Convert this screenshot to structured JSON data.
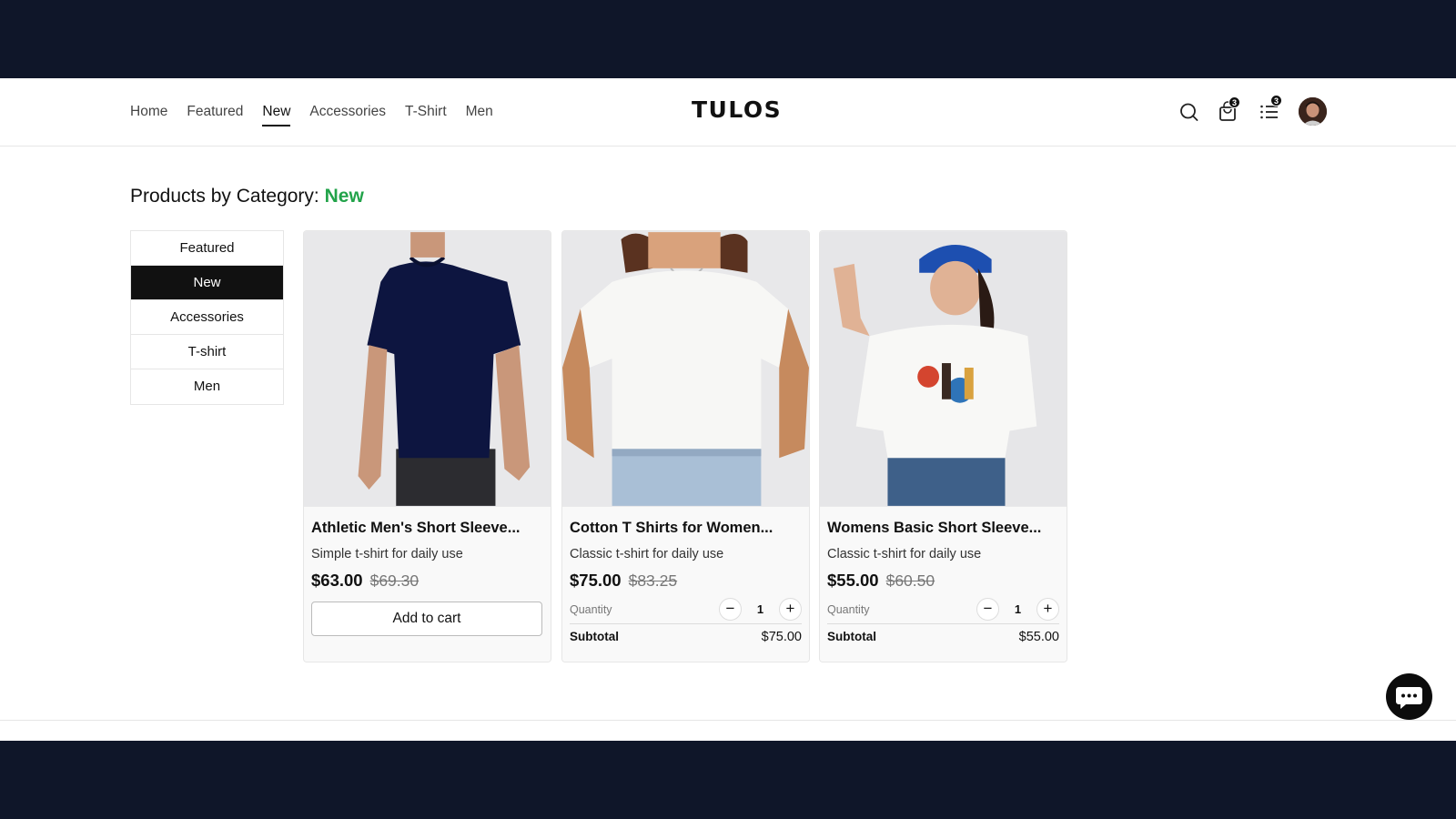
{
  "header": {
    "nav": [
      "Home",
      "Featured",
      "New",
      "Accessories",
      "T-Shirt",
      "Men"
    ],
    "active_nav": "New",
    "logo": "TULOS",
    "cart_count": "3",
    "orders_count": "3",
    "icons": [
      "search-icon",
      "shopping-bag-icon",
      "list-icon",
      "avatar"
    ]
  },
  "page": {
    "title_prefix": "Products by Category:",
    "title_category": "New",
    "accent_color": "#22a34a"
  },
  "sidebar": {
    "items": [
      "Featured",
      "New",
      "Accessories",
      "T-shirt",
      "Men"
    ],
    "active": "New"
  },
  "products": [
    {
      "name": "Athletic Men's Short Sleeve...",
      "description": "Simple t-shirt for daily use",
      "price": "$63.00",
      "old_price": "$69.30",
      "action_label": "Add to cart"
    },
    {
      "name": "Cotton T Shirts for Women...",
      "description": "Classic t-shirt for daily use",
      "price": "$75.00",
      "old_price": "$83.25",
      "quantity_label": "Quantity",
      "quantity": "1",
      "subtotal_label": "Subtotal",
      "subtotal": "$75.00"
    },
    {
      "name": "Womens Basic Short Sleeve...",
      "description": "Classic t-shirt for daily use",
      "price": "$55.00",
      "old_price": "$60.50",
      "quantity_label": "Quantity",
      "quantity": "1",
      "subtotal_label": "Subtotal",
      "subtotal": "$55.00"
    }
  ],
  "chat": {
    "icon": "chat-bubble-icon"
  }
}
